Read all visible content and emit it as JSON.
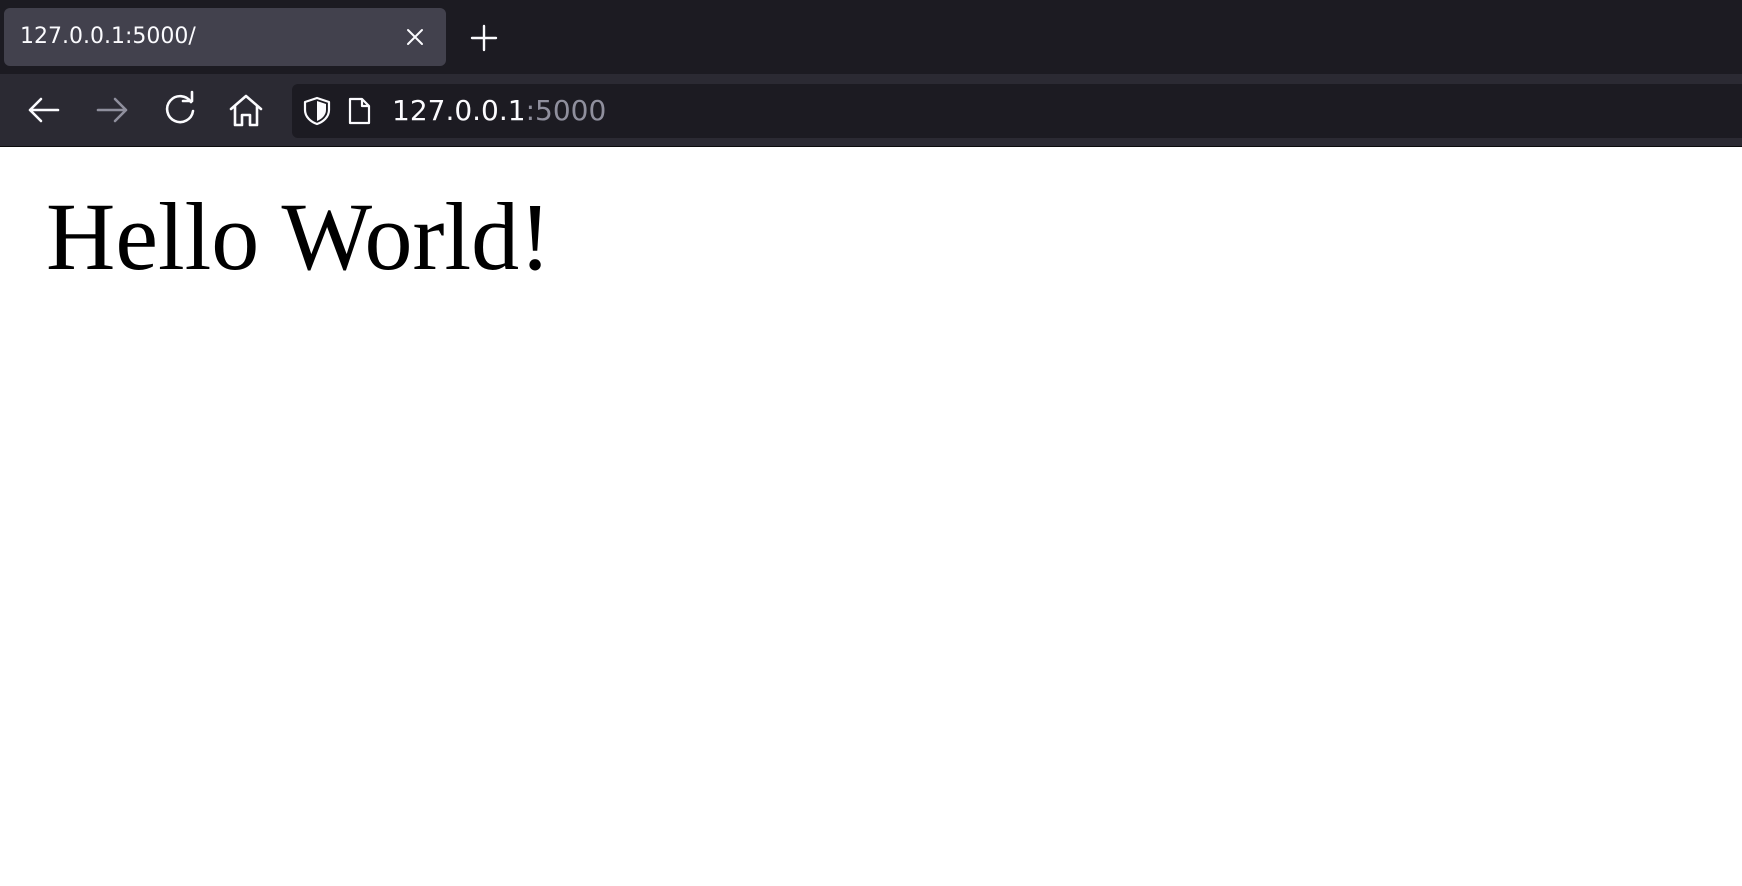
{
  "tab": {
    "title": "127.0.0.1:5000/",
    "close_icon": "close-icon"
  },
  "new_tab_icon": "plus-icon",
  "navbar": {
    "back_icon": "arrow-left-icon",
    "forward_icon": "arrow-right-icon",
    "reload_icon": "reload-icon",
    "home_icon": "home-icon"
  },
  "urlbar": {
    "shield_icon": "shield-icon",
    "page_icon": "page-icon",
    "host": "127.0.0.1",
    "port": ":5000"
  },
  "page": {
    "heading": "Hello World!"
  },
  "colors": {
    "tabstrip": "#1c1b22",
    "active_tab": "#42414d",
    "toolbar": "#2b2a33",
    "urlbar": "#1c1b22",
    "icon": "#fbfbfe",
    "icon_disabled": "#8f8f9d"
  }
}
